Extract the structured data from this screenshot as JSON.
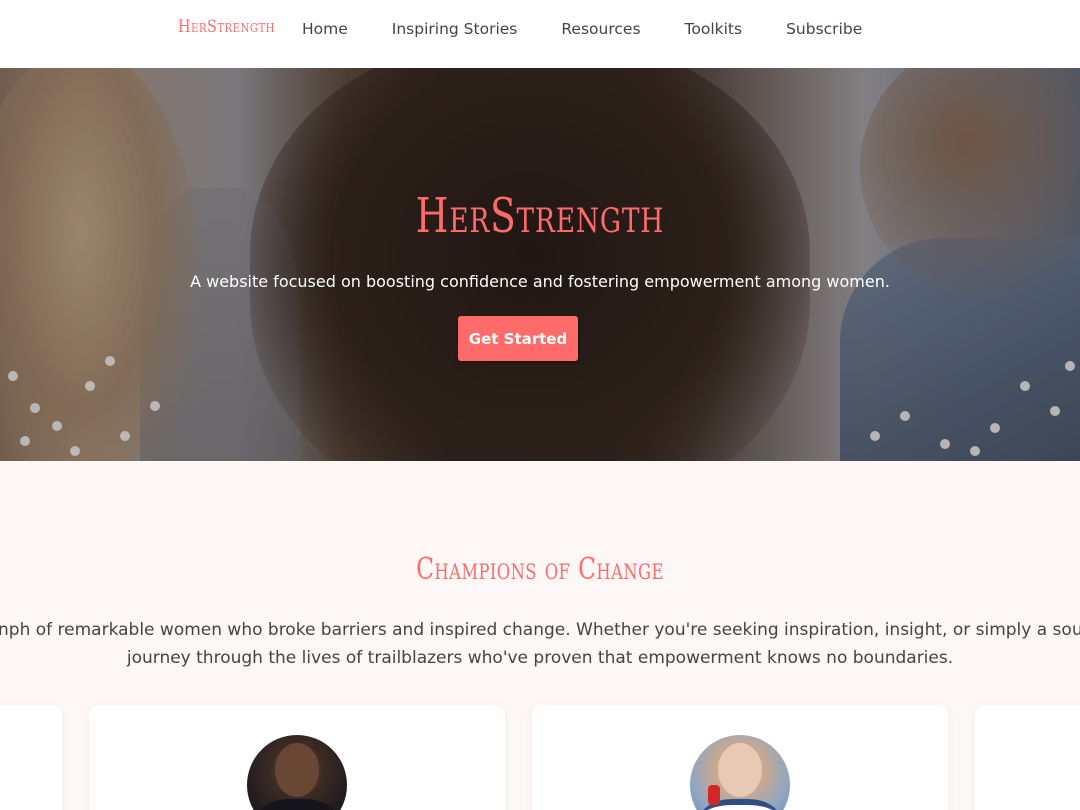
{
  "nav": {
    "brand": "HerStrength",
    "links": [
      "Home",
      "Inspiring Stories",
      "Resources",
      "Toolkits",
      "Subscribe"
    ]
  },
  "hero": {
    "title": "HerStrength",
    "subtitle": "A website focused on boosting confidence and fostering empowerment among women.",
    "cta_label": "Get Started"
  },
  "section": {
    "title": "Champions of Change",
    "desc_line1": "nph of remarkable women who broke barriers and inspired change. Whether you're seeking inspiration, insight, or simply a source of mot",
    "desc_line2": "journey through the lives of trailblazers who've proven that empowerment knows no boundaries."
  },
  "colors": {
    "accent": "#ff6b6b",
    "page_bg": "#fdf7f6",
    "card_bg": "#ffffff",
    "nav_text": "#444444"
  }
}
